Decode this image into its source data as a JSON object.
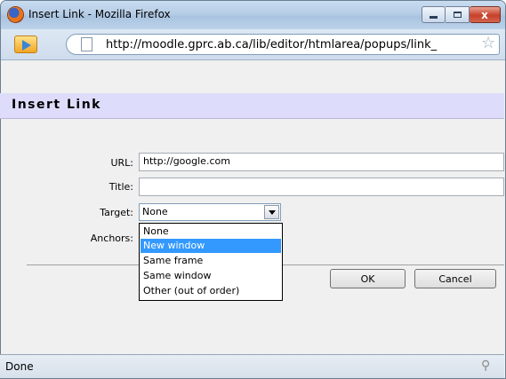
{
  "window": {
    "title": "Insert Link - Mozilla Firefox",
    "close_glyph": "x"
  },
  "address": {
    "url": "http://moodle.gprc.ab.ca/lib/editor/htmlarea/popups/link_"
  },
  "dialog": {
    "heading": "Insert Link",
    "fields": {
      "url_label": "URL:",
      "url_value": "http://google.com",
      "title_label": "Title:",
      "title_value": "",
      "target_label": "Target:",
      "target_selected": "None",
      "anchors_label": "Anchors:"
    },
    "target_options": [
      "None",
      "New window",
      "Same frame",
      "Same window",
      "Other (out of order)"
    ],
    "highlighted_option": "New window",
    "ok_label": "OK",
    "cancel_label": "Cancel"
  },
  "status": {
    "text": "Done"
  },
  "colors": {
    "heading_bg": "#ddddfb",
    "selection": "#3399ff"
  }
}
